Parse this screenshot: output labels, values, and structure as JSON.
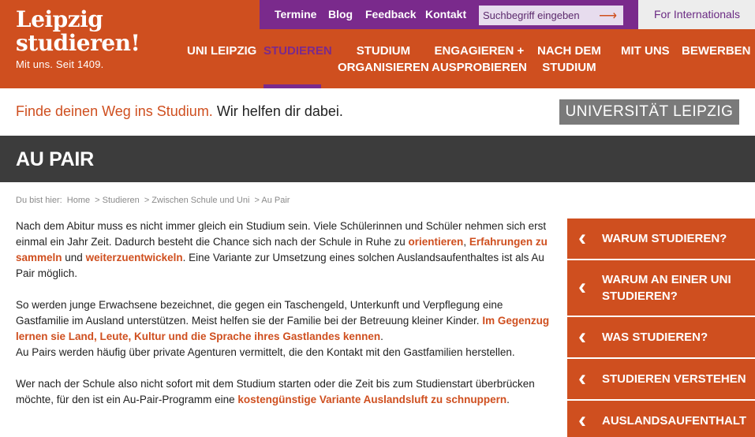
{
  "logo": {
    "line1": "Leipzig",
    "line2": "studieren!",
    "sub": "Mit uns. Seit 1409."
  },
  "topbar": {
    "links": [
      "Termine",
      "Blog",
      "Feedback",
      "Kontakt"
    ],
    "search_placeholder": "Suchbegriff eingeben",
    "international": "For Internationals"
  },
  "mainnav": {
    "items": [
      {
        "line1": "UNI LEIPZIG",
        "line2": ""
      },
      {
        "line1": "STUDIEREN",
        "line2": ""
      },
      {
        "line1": "STUDIUM",
        "line2": "ORGANISIEREN"
      },
      {
        "line1": "ENGAGIEREN +",
        "line2": "AUSPROBIEREN"
      },
      {
        "line1": "NACH DEM",
        "line2": "STUDIUM"
      },
      {
        "line1": "MIT UNS",
        "line2": ""
      },
      {
        "line1": "BEWERBEN",
        "line2": ""
      }
    ],
    "active": "STUDIEREN"
  },
  "slogan": {
    "highlight": "Finde deinen Weg ins Studium.",
    "rest": " Wir helfen dir dabei."
  },
  "university_logo": "UNIVERSITÄT LEIPZIG",
  "page_title": "AU PAIR",
  "breadcrumb": {
    "label": "Du bist hier:",
    "items": [
      "Home",
      "> Studieren",
      "> Zwischen Schule und Uni",
      "> Au Pair"
    ]
  },
  "content": {
    "p1": {
      "t1": "Nach dem Abitur muss es nicht immer gleich ein Studium sein. Viele Schülerinnen und Schüler nehmen sich erst einmal ein Jahr Zeit. Dadurch besteht die Chance sich nach der Schule in Ruhe zu ",
      "l1": "orientieren",
      "t2": ", ",
      "l2": "Erfahrungen zu sammeln",
      "t3": " und ",
      "l3": "weiterzuentwickeln",
      "t4": ". Eine Variante zur Umsetzung eines solchen Auslandsaufenthaltes ist als Au Pair möglich."
    },
    "p2": {
      "t1": "So werden junge Erwachsene bezeichnet, die gegen ein Taschengeld, Unterkunft und Verpflegung eine Gastfamilie im Ausland unterstützen. Meist helfen sie der Familie bei der Betreuung kleiner Kinder. ",
      "l1": "Im Gegenzug lernen sie Land, Leute, Kultur und die Sprache ihres Gastlandes kennen",
      "t2": ".",
      "t3": "Au Pairs werden häufig über private Agenturen vermittelt, die den Kontakt mit den Gastfamilien herstellen."
    },
    "p3": {
      "t1": "Wer nach der Schule also nicht sofort mit dem Studium starten oder die Zeit bis zum Studienstart überbrücken möchte, für den ist ein Au-Pair-Programm eine ",
      "l1": "kostengünstige Variante Auslandsluft zu schnuppern",
      "t2": "."
    }
  },
  "sidebar": {
    "items": [
      {
        "line1": "WARUM STUDIEREN?",
        "line2": ""
      },
      {
        "line1": "WARUM AN EINER UNI",
        "line2": "STUDIEREN?"
      },
      {
        "line1": "WAS STUDIEREN?",
        "line2": ""
      },
      {
        "line1": "STUDIEREN VERSTEHEN",
        "line2": ""
      },
      {
        "line1": "AUSLANDSAUFENTHALT",
        "line2": ""
      }
    ]
  },
  "colors": {
    "orange": "#cf4f1f",
    "purple": "#7a2a8c",
    "dark": "#3c3c3c",
    "grey": "#7a7a7a"
  },
  "icons": {
    "search": "arrow-right-icon",
    "sidebar": "chevron-left-icon"
  }
}
